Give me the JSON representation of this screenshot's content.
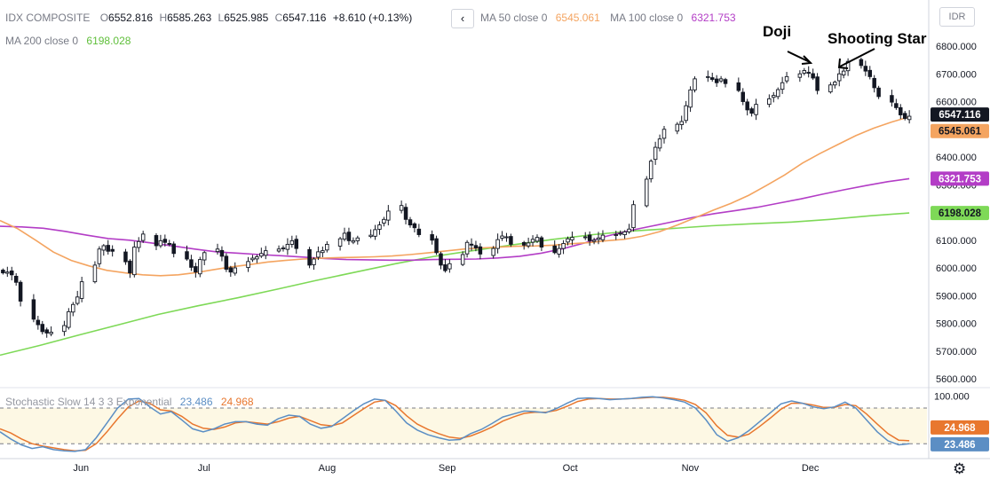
{
  "header": {
    "symbol": "IDX COMPOSITE",
    "o_label": "O",
    "o_value": "6552.816",
    "h_label": "H",
    "h_value": "6585.263",
    "l_label": "L",
    "l_value": "6525.985",
    "c_label": "C",
    "c_value": "6547.116",
    "change": "+8.610 (+0.13%)",
    "ma50_label": "MA 50 close 0",
    "ma50_value": "6545.061",
    "ma100_label": "MA 100 close 0",
    "ma100_value": "6321.753",
    "ma200_label": "MA 200 close 0",
    "ma200_value": "6198.028",
    "back_glyph": "‹",
    "currency": "IDR",
    "settings_icon": "gear-icon",
    "settings_glyph": "⚙"
  },
  "stoch_legend": {
    "label": "Stochastic Slow 14 3 3 Exponential",
    "k_value": "23.486",
    "d_value": "24.968"
  },
  "annotations": {
    "doji": "Doji",
    "shooting_star": "Shooting Star"
  },
  "colors": {
    "ma50": "#f4a460",
    "ma100": "#b33dc6",
    "ma200": "#7ed957",
    "stoch_k": "#5b8ec4",
    "stoch_d": "#e8772e",
    "band": "#fdf8e4",
    "price_tag": "#131722"
  },
  "chart_data": [
    {
      "type": "candlestick",
      "ylim": [
        5580,
        6880
      ],
      "y_ticks": [
        "6800.000",
        "6700.000",
        "6600.000",
        "6500.000",
        "6400.000",
        "6300.000",
        "6200.000",
        "6100.000",
        "6000.000",
        "5900.000",
        "5800.000",
        "5700.000",
        "5600.000"
      ],
      "x_labels": [
        "Jun",
        "Jul",
        "Aug",
        "Sep",
        "Oct",
        "Nov",
        "Dec"
      ],
      "x_label_days": [
        19,
        60,
        101,
        141,
        182,
        222,
        262
      ],
      "day_range": [
        -8,
        300
      ],
      "last_price_label": "6547.116",
      "ma50_label": "6545.061",
      "ma100_label": "6321.753",
      "ma200_label": "6198.028",
      "closes": [
        5982,
        5985,
        5975,
        5948,
        5880,
        5815,
        5795,
        5770,
        5765,
        5768,
        5792,
        5842,
        5868,
        5895,
        5950,
        6010,
        6068,
        6080,
        6060,
        6060,
        6022,
        5982,
        6075,
        6095,
        6122,
        6080,
        6098,
        6092,
        6085,
        6052,
        6032,
        6002,
        5985,
        6030,
        6055,
        6068,
        6042,
        5995,
        5985,
        6000,
        6023,
        6035,
        6040,
        6052,
        6062,
        6068,
        6072,
        6085,
        6098,
        6070,
        6010,
        6032,
        6058,
        6062,
        6085,
        6105,
        6125,
        6098,
        6098,
        6108,
        6118,
        6138,
        6155,
        6175,
        6205,
        6225,
        6175,
        6155,
        6145,
        6120,
        6100,
        6055,
        6010,
        5990,
        6015,
        6048,
        6092,
        6082,
        6072,
        6050,
        6070,
        6102,
        6115,
        6112,
        6085,
        6082,
        6090,
        6103,
        6110,
        6075,
        6055,
        6070,
        6088,
        6105,
        6110,
        6112,
        6098,
        6100,
        6108,
        6118,
        6120,
        6125,
        6130,
        6140,
        6228,
        6320,
        6385,
        6435,
        6465,
        6500,
        6518,
        6528,
        6585,
        6642,
        6682,
        6690,
        6680,
        6668,
        6682,
        6665,
        6640,
        6600,
        6570,
        6558,
        6590,
        6610,
        6622,
        6643,
        6668,
        6690,
        6700,
        6712,
        6702,
        6685,
        6640,
        6660,
        6670,
        6700,
        6710,
        6745,
        6730,
        6710,
        6690,
        6650,
        6618,
        6598,
        6578,
        6552,
        6539,
        6547
      ],
      "ma50": [
        6171,
        6141,
        6100,
        6057,
        6027,
        6007,
        5991,
        5982,
        5975,
        5972,
        5975,
        5983,
        5994,
        6004,
        6012,
        6021,
        6027,
        6032,
        6035,
        6037,
        6038,
        6040,
        6043,
        6048,
        6054,
        6061,
        6068,
        6072,
        6075,
        6078,
        6079,
        6082,
        6087,
        6091,
        6098,
        6103,
        6114,
        6131,
        6155,
        6181,
        6208,
        6233,
        6262,
        6298,
        6335,
        6378,
        6413,
        6445,
        6477,
        6504,
        6526,
        6545
      ],
      "ma100": [
        6150,
        6148,
        6143,
        6132,
        6118,
        6106,
        6100,
        6090,
        6079,
        6068,
        6058,
        6053,
        6048,
        6044,
        6039,
        6034,
        6030,
        6029,
        6028,
        6028,
        6030,
        6031,
        6032,
        6036,
        6042,
        6053,
        6069,
        6090,
        6114,
        6133,
        6149,
        6165,
        6182,
        6196,
        6207,
        6219,
        6234,
        6249,
        6266,
        6282,
        6297,
        6311,
        6322
      ],
      "ma200": [
        5685,
        5720,
        5758,
        5795,
        5832,
        5863,
        5892,
        5923,
        5955,
        5985,
        6015,
        6042,
        6063,
        6084,
        6103,
        6120,
        6133,
        6142,
        6152,
        6159,
        6165,
        6175,
        6188,
        6198
      ]
    },
    {
      "type": "line",
      "title": "Stochastic Slow 14 3 3 Exponential",
      "ylim": [
        0,
        100
      ],
      "y_ticks": [
        "100.000"
      ],
      "bands": [
        80,
        20
      ],
      "k_label": "23.486",
      "d_label": "24.968",
      "k": [
        40,
        28,
        18,
        12,
        15,
        10,
        8,
        7,
        10,
        30,
        55,
        80,
        95,
        96,
        82,
        70,
        74,
        60,
        45,
        40,
        45,
        53,
        57,
        57,
        53,
        51,
        62,
        68,
        66,
        53,
        46,
        49,
        62,
        75,
        87,
        95,
        93,
        75,
        55,
        43,
        35,
        30,
        26,
        27,
        37,
        44,
        54,
        65,
        70,
        75,
        74,
        72,
        79,
        88,
        96,
        97,
        96,
        94,
        95,
        96,
        98,
        99,
        97,
        94,
        90,
        80,
        60,
        35,
        24,
        30,
        42,
        57,
        72,
        87,
        92,
        88,
        82,
        79,
        82,
        90,
        80,
        60,
        40,
        25,
        18,
        20
      ],
      "d": [
        45,
        38,
        28,
        20,
        16,
        13,
        10,
        8,
        9,
        20,
        40,
        62,
        82,
        92,
        88,
        77,
        75,
        66,
        53,
        46,
        44,
        48,
        55,
        57,
        55,
        53,
        57,
        63,
        66,
        59,
        52,
        50,
        55,
        67,
        79,
        90,
        93,
        84,
        67,
        53,
        44,
        37,
        31,
        29,
        33,
        40,
        48,
        58,
        65,
        71,
        73,
        73,
        76,
        83,
        91,
        95,
        96,
        95,
        95,
        96,
        97,
        98,
        98,
        96,
        93,
        86,
        72,
        50,
        34,
        31,
        36,
        49,
        63,
        78,
        88,
        88,
        85,
        81,
        81,
        86,
        84,
        70,
        53,
        37,
        26,
        25
      ]
    }
  ]
}
